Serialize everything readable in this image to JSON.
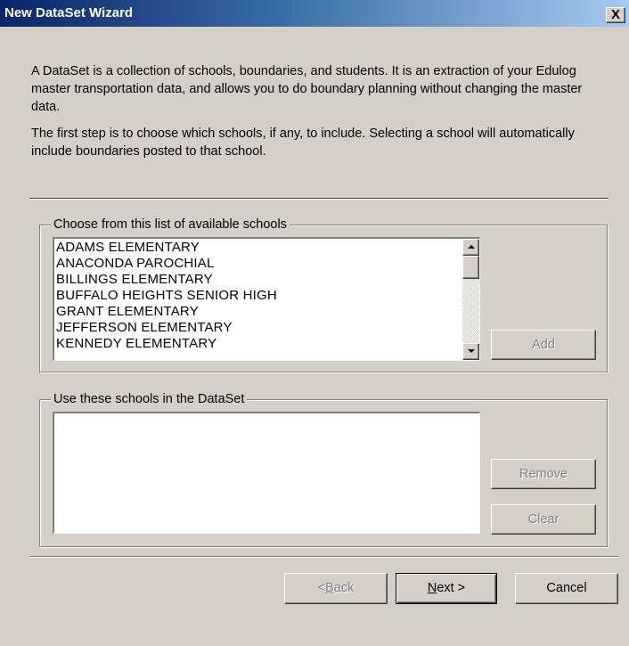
{
  "window": {
    "title": "New DataSet Wizard",
    "close_glyph": "X"
  },
  "intro": {
    "paragraph1": "A DataSet is a collection of schools, boundaries, and students.  It is an extraction of your Edulog master transportation data, and allows you to do boundary planning without changing the master data.",
    "paragraph2": "The first step is to choose which schools, if any, to include.  Selecting a school will automatically include boundaries posted to that school."
  },
  "available_group": {
    "label": "Choose from this list of available schools",
    "schools": [
      "ADAMS ELEMENTARY",
      "ANACONDA PAROCHIAL",
      "BILLINGS ELEMENTARY",
      "BUFFALO HEIGHTS SENIOR HIGH",
      "GRANT ELEMENTARY",
      "JEFFERSON ELEMENTARY",
      "KENNEDY ELEMENTARY"
    ],
    "add_label": "Add"
  },
  "selected_group": {
    "label": "Use these schools in the DataSet",
    "schools": [],
    "remove_label": "Remove",
    "clear_label": "Clear"
  },
  "footer": {
    "back_prefix": "< ",
    "back_hotkey": "B",
    "back_rest": "ack",
    "next_hotkey": "N",
    "next_rest": "ext >",
    "cancel_label": "Cancel"
  },
  "icons": {
    "scroll_up": "triangle-up",
    "scroll_down": "triangle-down"
  },
  "colors": {
    "title_gradient_start": "#0a246a",
    "title_gradient_end": "#a6caf0",
    "dialog_face": "#d4d0c8",
    "disabled_text": "#808080"
  }
}
